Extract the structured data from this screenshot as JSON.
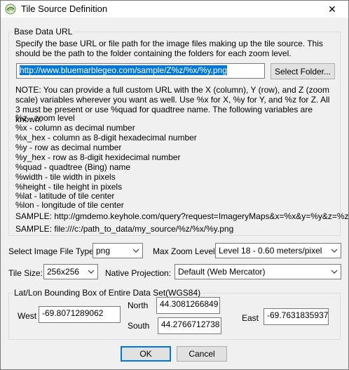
{
  "window": {
    "title": "Tile Source Definition",
    "close_glyph": "✕"
  },
  "base": {
    "legend": "Base Data URL",
    "description": "Specify the base URL or file path for the image files making up the tile source. This should be the path to the folder containing the folders for each zoom level.",
    "url_value": "http://www.bluemarblegeo.com/sample/Z%z/%x/%y.png",
    "select_folder_label": "Select Folder...",
    "note": "NOTE: You can provide a full custom URL with the X (column), Y (row), and Z (zoom scale) variables wherever you want as well. Use %x for X, %y for Y, and %z for Z. All 3 must be present or use %quad for quadtree name. The following variables are known:",
    "variables": [
      "%z - zoom level",
      "%x - column as decimal number",
      "%x_hex - column as 8-digit hexadecimal number",
      "%y - row as decimal number",
      "%y_hex - row as 8-digit hexidecimal number",
      "%quad - quadtree (Bing) name",
      "%width - tile width in pixels",
      "%height - tile height in pixels",
      "%lat - latitude of tile center",
      "%lon - longitude of tile center"
    ],
    "sample1": "SAMPLE: http://gmdemo.keyhole.com/query?request=ImageryMaps&x=%x&y=%y&z=%z",
    "sample2": "SAMPLE: file:///c:/path_to_data/my_source/%z/%x/%y.png"
  },
  "options": {
    "file_type_label": "Select Image File Type:",
    "file_type_value": "png",
    "max_zoom_label": "Max Zoom Level:",
    "max_zoom_value": "Level 18 - 0.60 meters/pixel",
    "tile_size_label": "Tile Size:",
    "tile_size_value": "256x256",
    "projection_label": "Native Projection:",
    "projection_value": "Default (Web Mercator)"
  },
  "bbox": {
    "legend": "Lat/Lon Bounding Box of Entire Data Set(WGS84)",
    "west_label": "West",
    "west_value": "-69.8071289062",
    "north_label": "North",
    "north_value": "44.3081266849",
    "south_label": "South",
    "south_value": "44.2766712738",
    "east_label": "East",
    "east_value": "-69.7631835937"
  },
  "buttons": {
    "ok": "OK",
    "cancel": "Cancel"
  }
}
